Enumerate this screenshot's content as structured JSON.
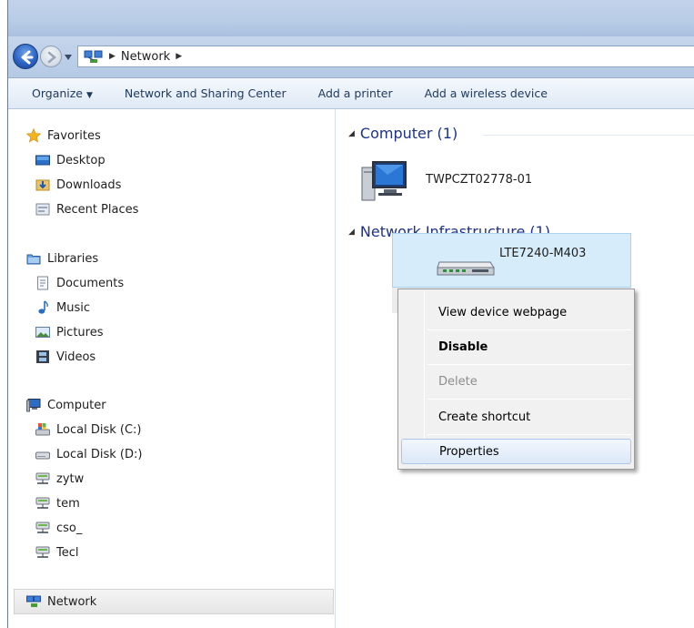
{
  "address": {
    "location_icon": "network-icon",
    "crumbs": [
      "Network"
    ]
  },
  "toolbar": {
    "organize": "Organize",
    "network_sharing": "Network and Sharing Center",
    "add_printer": "Add a printer",
    "add_wireless": "Add a wireless device"
  },
  "nav": {
    "favorites": "Favorites",
    "desktop": "Desktop",
    "downloads": "Downloads",
    "recent_places": "Recent Places",
    "libraries": "Libraries",
    "documents": "Documents",
    "music": "Music",
    "pictures": "Pictures",
    "videos": "Videos",
    "computer": "Computer",
    "local_c": "Local Disk (C:)",
    "local_d": "Local Disk (D:)",
    "net1": "zytw",
    "net2": "tem",
    "net3": "cso_",
    "net4": "Tecl",
    "network": "Network"
  },
  "content": {
    "group_computer": "Computer (1)",
    "computer_name": "TWPCZT02778-01",
    "group_infra": "Network Infrastructure (1)",
    "device_name": "LTE7240-M403"
  },
  "context_menu": {
    "view_webpage": "View device webpage",
    "disable": "Disable",
    "delete": "Delete",
    "create_shortcut": "Create shortcut",
    "properties": "Properties"
  },
  "colors": {
    "accent": "#1e3287",
    "selection": "#d6ecfa"
  }
}
